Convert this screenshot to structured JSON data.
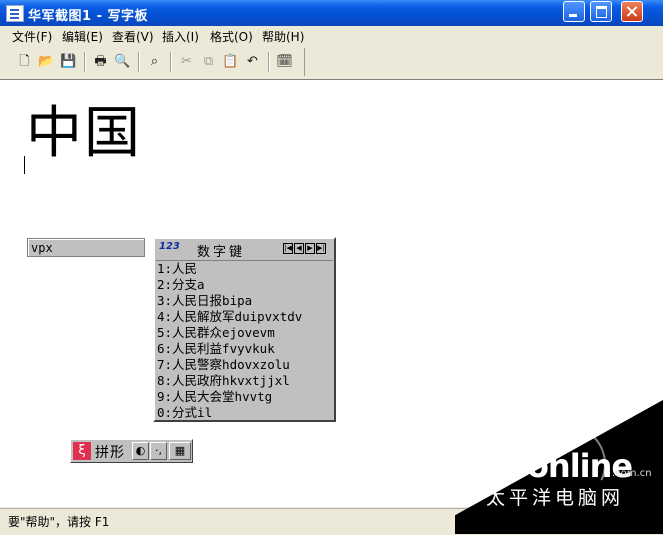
{
  "window": {
    "title": "华军截图1 - 写字板"
  },
  "menu": [
    "文件(F)",
    "编辑(E)",
    "查看(V)",
    "插入(I)",
    "格式(O)",
    "帮助(H)"
  ],
  "toolbar": {
    "icons": [
      "new-icon",
      "open-icon",
      "save-icon",
      "print-icon",
      "print-preview-icon",
      "find-icon",
      "cut-icon",
      "copy-icon",
      "paste-icon",
      "undo-icon",
      "insert-datetime-icon"
    ]
  },
  "document": {
    "text": "中国"
  },
  "ime": {
    "composition": "vpx",
    "candidate_logo": "123",
    "candidate_title": "数字键",
    "nav_buttons": [
      "|◀",
      "◀",
      "▶",
      "▶|"
    ],
    "candidates": [
      "1:人民",
      "2:分支a",
      "3:人民日报bipa",
      "4:人民解放军duipvxtdv",
      "5:人民群众ejovevm",
      "6:人民利益fvyvkuk",
      "7:人民警察hdovxzolu",
      "8:人民政府hkvxtjjxl",
      "9:人民大会堂hvvtg",
      "0:分式il"
    ],
    "status_logo": "ξ",
    "mode_label": "拼形"
  },
  "statusbar": {
    "text": "要\"帮助\"，请按 F1"
  },
  "watermark": {
    "logo": "PConline",
    "domain": ".com.cn",
    "cn": "太平洋电脑网"
  }
}
